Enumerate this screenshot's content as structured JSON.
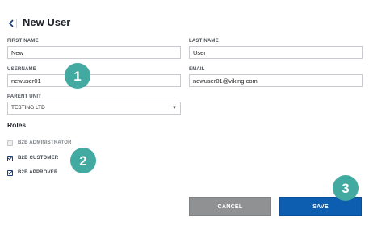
{
  "header": {
    "title": "New User"
  },
  "form": {
    "first_name": {
      "label": "FIRST NAME",
      "value": "New"
    },
    "last_name": {
      "label": "LAST NAME",
      "value": "User"
    },
    "username": {
      "label": "USERNAME",
      "value": "newuser01"
    },
    "email": {
      "label": "EMAIL",
      "value": "newuser01@viking.com"
    },
    "parent_unit": {
      "label": "PARENT UNIT",
      "value": "TESTING LTD"
    }
  },
  "roles": {
    "heading": "Roles",
    "items": [
      {
        "label": "B2B ADMINISTRATOR",
        "checked": false,
        "disabled": true
      },
      {
        "label": "B2B CUSTOMER",
        "checked": true,
        "disabled": false
      },
      {
        "label": "B2B APPROVER",
        "checked": true,
        "disabled": false
      }
    ]
  },
  "actions": {
    "cancel_label": "CANCEL",
    "save_label": "SAVE"
  },
  "callouts": [
    "1",
    "2",
    "3"
  ],
  "colors": {
    "accent": "#0d5eb0",
    "cancel": "#8f9193",
    "callout": "#42aaa0"
  },
  "icons": {
    "back": "chevron-left-icon",
    "select": "chevron-down-icon",
    "checkbox": "checkbox-icon"
  }
}
